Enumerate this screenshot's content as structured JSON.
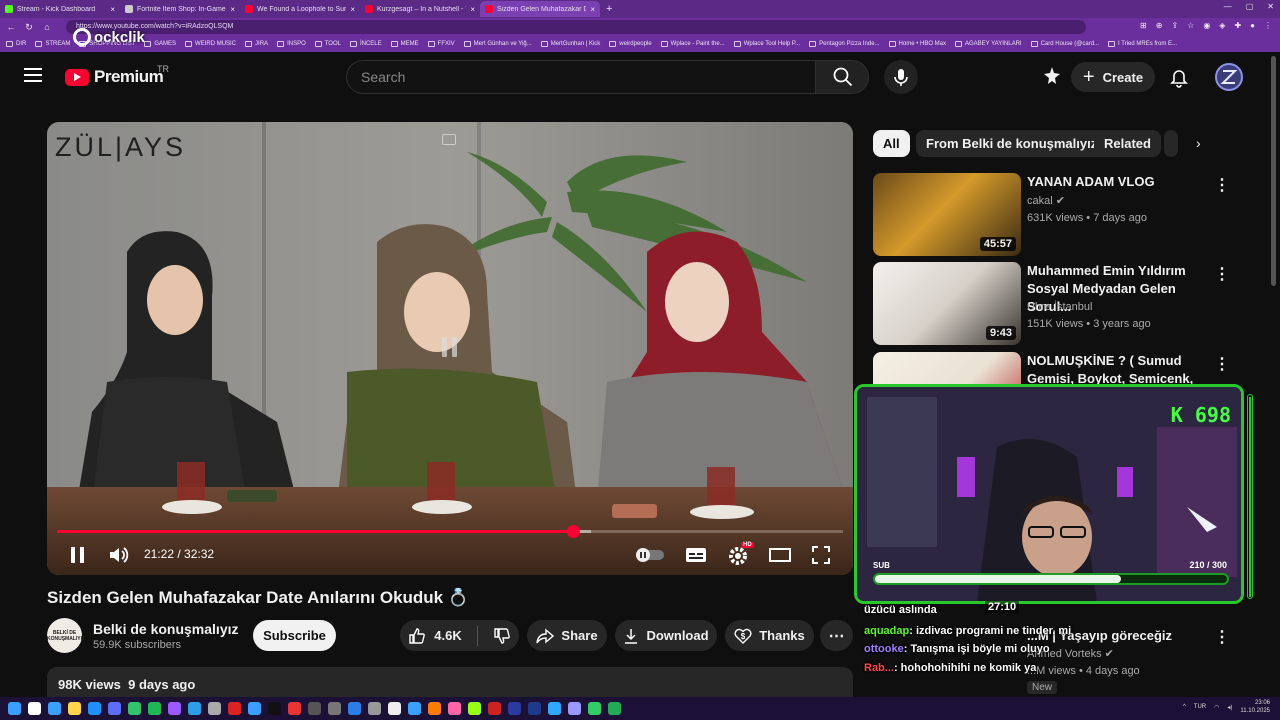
{
  "browser": {
    "tabs": [
      {
        "label": "Stream - Kick Dashboard",
        "color": "#53fc18"
      },
      {
        "label": "Fortnite Item Shop: In-Game Co...",
        "color": "#cccccc"
      },
      {
        "label": "We Found a Loophole to Survive...",
        "color": "#ff0033"
      },
      {
        "label": "Kurzgesagt – In a Nutshell - YouT...",
        "color": "#ff0033"
      },
      {
        "label": "Sizden Gelen Muhafazakar D...",
        "color": "#ff0033"
      }
    ],
    "new_tab": "+",
    "url": "https://www.youtube.com/watch?v=iRAdzoQLSQM",
    "bookmarks": [
      "DIR",
      "STREAM",
      "SHOPPING LIST",
      "GAMES",
      "WEIRD MUSIC",
      "JIRA",
      "INSPO",
      "TOOL",
      "İNCELE",
      "MEME",
      "FFXIV",
      "Mert Günhan ve Yiğ...",
      "MertGunhan | Kick",
      "weirdpeople",
      "Wplace - Paint the...",
      "Wplace Tool Help P...",
      "Pentagon Pizza Inde...",
      "Home • HBO Max",
      "AGABEY YAYINLARI",
      "Card House (@card...",
      "I Tried MREs from E..."
    ]
  },
  "watermark": {
    "text": "ockclik"
  },
  "header": {
    "logo_text": "Premium",
    "region": "TR",
    "search_placeholder": "Search",
    "create_label": "Create"
  },
  "player": {
    "brand_text": "ZÜL|AYS",
    "current_time": "21:22",
    "duration": "32:32",
    "time_display": "21:22 / 32:32",
    "progress": 0.657,
    "buffered": 0.68,
    "quality_badge": "HD"
  },
  "video": {
    "title": "Sizden Gelen Muhafazakar Date Anılarını Okuduk 💍",
    "channel": "Belki de konuşmalıyız",
    "channel_avatar_text": "BELKİ DE KONUŞMALIYIZ",
    "subscribers": "59.9K subscribers",
    "subscribe_label": "Subscribe",
    "likes": "4.6K",
    "share_label": "Share",
    "download_label": "Download",
    "thanks_label": "Thanks",
    "views": "98K views",
    "age": "9 days ago"
  },
  "sidebar": {
    "chips": [
      "All",
      "From Belki de konuşmalıyız",
      "Related"
    ],
    "recommendations": [
      {
        "title": "YANAN ADAM VLOG",
        "channel": "cakal",
        "meta": "631K views • 7 days ago",
        "duration": "45:57"
      },
      {
        "title": "Muhammed Emin Yıldırım Sosyal Medyadan Gelen Sorul...",
        "channel": "Uhre İstanbul",
        "meta": "151K views • 3 years ago",
        "duration": "9:43"
      },
      {
        "title": "NOLMUŞKİNE ? ( Sumud Gemisi, Boykot, Semicenk, ...",
        "channel": "",
        "meta": "",
        "duration": ""
      },
      {
        "title": "...M | Yaşayıp göreceğiz",
        "channel": "Ahmed Vorteks",
        "meta": "...M views • 4 days ago",
        "duration": "",
        "badge": "New"
      }
    ]
  },
  "stream_overlay": {
    "viewer_count": "698",
    "sub_label": "SUB",
    "sub_goal": "210 / 300",
    "sub_progress": 0.7,
    "timer": "27:10"
  },
  "chat": [
    {
      "user": "",
      "text": "üzücü aslında",
      "color": "#ffffff"
    },
    {
      "user": "aquadap",
      "text": ": izdivac programi ne tinder. mi",
      "color": "#53fc18"
    },
    {
      "user": "ottooke",
      "text": ": Tanışma işi böyle mi oluyo",
      "color": "#9d7bff"
    },
    {
      "user": "Rab...",
      "text": ": hohohohihihi ne komik ya",
      "color": "#ff4646"
    }
  ],
  "taskbar": {
    "language": "TUR",
    "time": "23:06",
    "date": "11.10.2025"
  }
}
